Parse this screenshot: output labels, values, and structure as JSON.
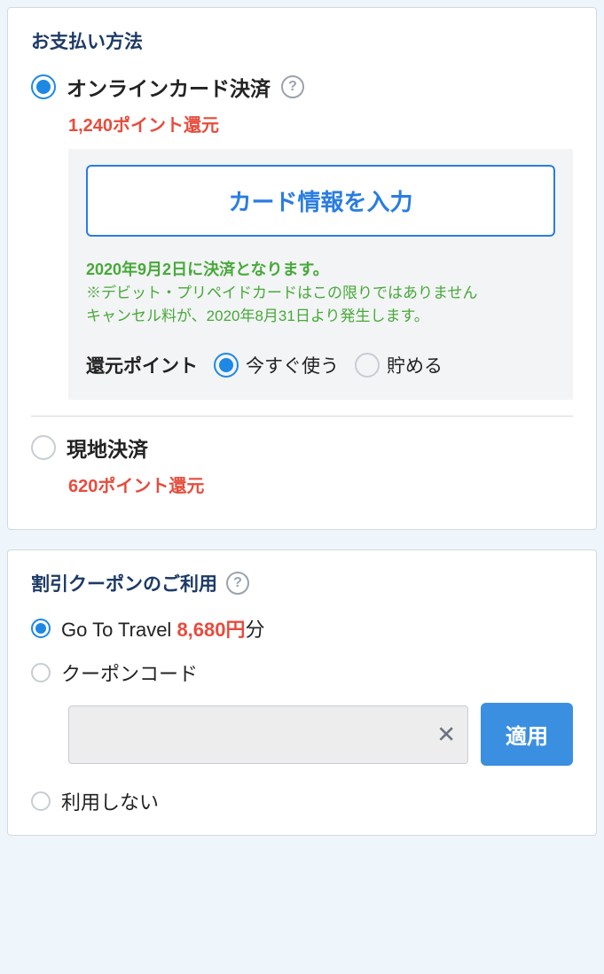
{
  "payment": {
    "title": "お支払い方法",
    "online": {
      "label": "オンラインカード決済",
      "points_text": "1,240ポイント還元",
      "card_button": "カード情報を入力",
      "info_bold": "2020年9月2日に決済となります。",
      "info_sub1": "※デビット・プリペイドカードはこの限りではありません",
      "info_sub2": "キャンセル料が、2020年8月31日より発生します。",
      "points_use_label": "還元ポイント",
      "option_use_now": "今すぐ使う",
      "option_save": "貯める"
    },
    "onsite": {
      "label": "現地決済",
      "points_text": "620ポイント還元"
    }
  },
  "coupon": {
    "title": "割引クーポンのご利用",
    "goto_label_prefix": "Go To Travel ",
    "goto_amount": "8,680円",
    "goto_suffix": "分",
    "code_label": "クーポンコード",
    "apply_label": "適用",
    "none_label": "利用しない"
  }
}
